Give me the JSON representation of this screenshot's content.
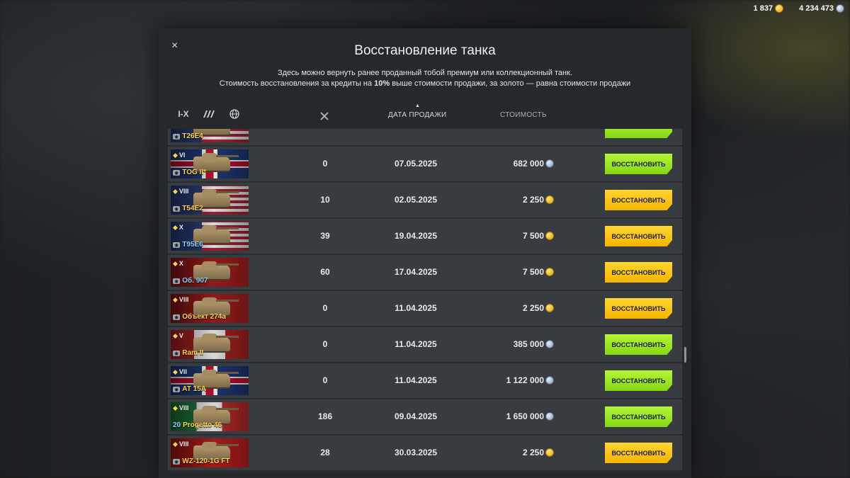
{
  "topbar": {
    "gold": "1 837",
    "credits": "4 234 473"
  },
  "modal": {
    "close": "×",
    "title": "Восстановление танка",
    "desc_line1": "Здесь можно вернуть ранее проданный тобой премиум или коллекционный танк.",
    "desc_line2_a": "Стоимость восстановления за кредиты на ",
    "desc_line2_b": "10%",
    "desc_line2_c": " выше стоимости продажи, за золото — равна стоимости продажи"
  },
  "filters": {
    "tier": "I-X"
  },
  "headers": {
    "date": "ДАТА ПРОДАЖИ",
    "cost": "СТОИМОСТЬ"
  },
  "rows": [
    {
      "tier": "",
      "name": "T26E4",
      "battles": "",
      "date": "",
      "cost": "",
      "currency": "",
      "button": "",
      "flag": "us"
    },
    {
      "tier": "VI",
      "name": "TOG II*",
      "battles": "0",
      "date": "07.05.2025",
      "cost": "682 000",
      "currency": "credits",
      "button": "ВОССТАНОВИТЬ",
      "flag": "uk"
    },
    {
      "tier": "VIII",
      "name": "T54E2",
      "battles": "10",
      "date": "02.05.2025",
      "cost": "2 250",
      "currency": "gold",
      "button": "ВОССТАНОВИТЬ",
      "flag": "us"
    },
    {
      "tier": "X",
      "name": "T95E6",
      "battles": "39",
      "date": "19.04.2025",
      "cost": "7 500",
      "currency": "gold",
      "button": "ВОССТАНОВИТЬ",
      "flag": "us"
    },
    {
      "tier": "X",
      "name": "Об. 907",
      "battles": "60",
      "date": "17.04.2025",
      "cost": "7 500",
      "currency": "gold",
      "button": "ВОССТАНОВИТЬ",
      "flag": "ussr"
    },
    {
      "tier": "VIII",
      "name": "Объект 274а",
      "battles": "0",
      "date": "11.04.2025",
      "cost": "2 250",
      "currency": "gold",
      "button": "ВОССТАНОВИТЬ",
      "flag": "ussr"
    },
    {
      "tier": "V",
      "name": "Ram II",
      "battles": "0",
      "date": "11.04.2025",
      "cost": "385 000",
      "currency": "credits",
      "button": "ВОССТАНОВИТЬ",
      "flag": "ca"
    },
    {
      "tier": "VII",
      "name": "AT 15A",
      "battles": "0",
      "date": "11.04.2025",
      "cost": "1 122 000",
      "currency": "credits",
      "button": "ВОССТАНОВИТЬ",
      "flag": "uk"
    },
    {
      "tier": "VIII",
      "name": "Progetto 46",
      "level_badge": "20",
      "battles": "186",
      "date": "09.04.2025",
      "cost": "1 650 000",
      "currency": "credits",
      "button": "ВОССТАНОВИТЬ",
      "flag": "it"
    },
    {
      "tier": "VIII",
      "name": "WZ-120-1G FT",
      "battles": "28",
      "date": "30.03.2025",
      "cost": "2 250",
      "currency": "gold",
      "button": "ВОССТАНОВИТЬ",
      "flag": "cn"
    }
  ]
}
